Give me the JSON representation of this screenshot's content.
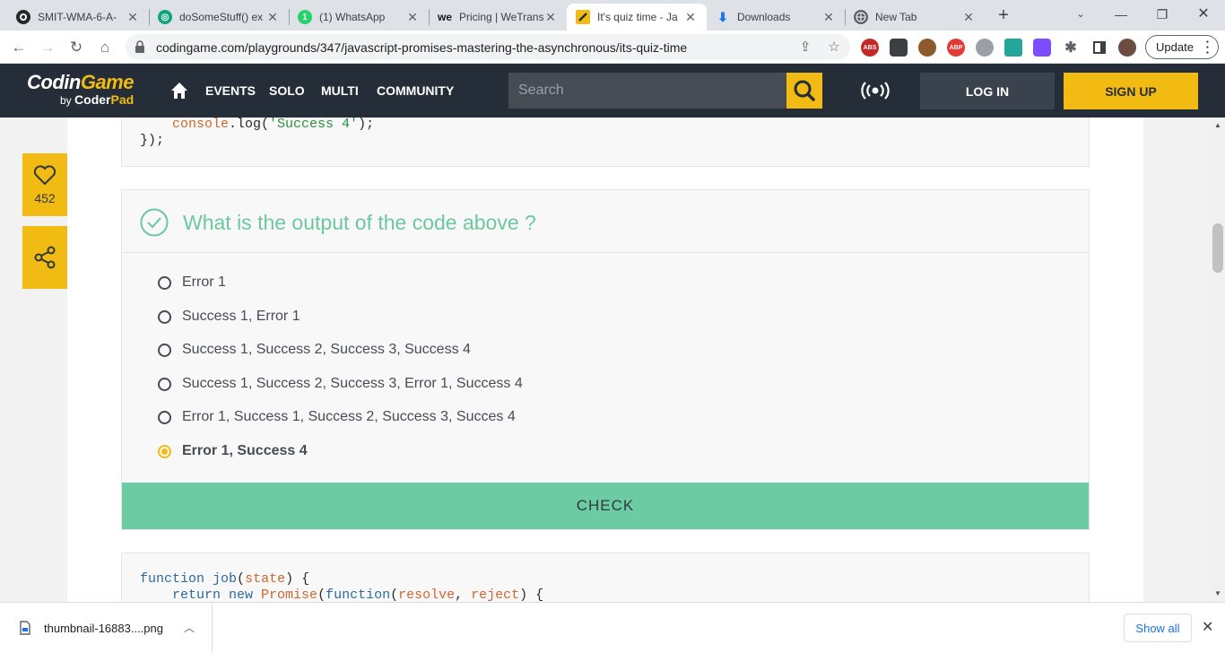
{
  "browser": {
    "tabs": [
      {
        "title": "SMIT-WMA-6-A-",
        "icon": "github-icon",
        "color": "#24292f"
      },
      {
        "title": "doSomeStuff() ex",
        "icon": "openai-icon",
        "color": "#10a37f"
      },
      {
        "title": "(1) WhatsApp",
        "icon": "whatsapp-icon",
        "color": "#25d366",
        "badge": "1"
      },
      {
        "title": "Pricing | WeTrans",
        "icon": "wetransfer-icon",
        "color": "#17181a",
        "mark": "we"
      },
      {
        "title": "It's quiz time - Ja",
        "icon": "codingame-icon",
        "color": "#f2bb13"
      },
      {
        "title": "Downloads",
        "icon": "download-icon",
        "color": "#1a73e8"
      },
      {
        "title": "New Tab",
        "icon": "globe-icon",
        "color": "#5f6368"
      }
    ],
    "url": "codingame.com/playgrounds/347/javascript-promises-mastering-the-asynchronous/its-quiz-time",
    "update_label": "Update",
    "extensions": [
      {
        "name": "abs-extension-icon",
        "label": "ABS",
        "color": "#c62828"
      },
      {
        "name": "robot-extension-icon",
        "label": "",
        "color": "#3c4043"
      },
      {
        "name": "cookie-extension-icon",
        "label": "",
        "color": "#8d5a2b"
      },
      {
        "name": "adblock-plus-icon",
        "label": "ABP",
        "color": "#e53935"
      },
      {
        "name": "links-extension-icon",
        "label": "",
        "color": "#9aa0a6"
      },
      {
        "name": "eyedropper-extension-icon",
        "label": "",
        "color": "#26a69a"
      },
      {
        "name": "gradient-extension-icon",
        "label": "",
        "color": "#7c4dff"
      }
    ]
  },
  "header": {
    "logo_main_a": "Codin",
    "logo_main_b": "Game",
    "logo_by": "by",
    "logo_coder": "Coder",
    "logo_pad": "Pad",
    "nav": [
      "EVENTS",
      "SOLO",
      "MULTI",
      "COMMUNITY"
    ],
    "search_placeholder": "Search",
    "login_label": "LOG IN",
    "signup_label": "SIGN UP",
    "accent_color": "#f2bb13"
  },
  "sidebar": {
    "likes": "452"
  },
  "code_top": {
    "line1_obj": "console",
    "line1_rest": ".log(",
    "line1_str": "'Success 4'",
    "line1_end": ");",
    "line2": "});"
  },
  "quiz": {
    "question": "What is the output of the code above ?",
    "options": [
      "Error 1",
      "Success 1, Error 1",
      "Success 1, Success 2, Success 3, Success 4",
      "Success 1, Success 2, Success 3, Error 1, Success 4",
      "Error 1, Success 1, Success 2, Success 3, Succes 4",
      "Error 1, Success 4"
    ],
    "selected_index": 5,
    "check_label": "CHECK"
  },
  "code_bottom": {
    "l1_kw": "function",
    "l1_name": "job",
    "l1_param": "state",
    "l2_ret": "return new",
    "l2_cls": "Promise",
    "l2_fn": "function",
    "l2_a": "resolve",
    "l2_b": "reject"
  },
  "downloads": {
    "file": "thumbnail-16883....png",
    "show_all": "Show all"
  }
}
